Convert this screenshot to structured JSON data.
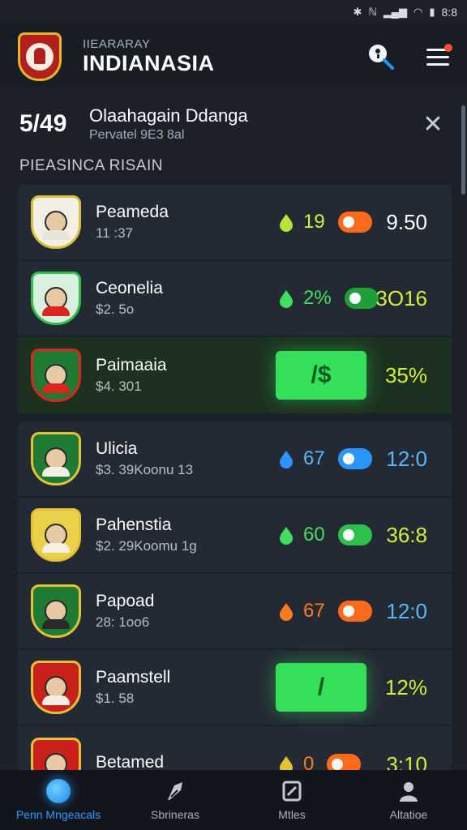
{
  "status_bar": {
    "time": "8:8"
  },
  "app": {
    "brand_sub": "IIEARARAY",
    "brand_title": "INDIANASIA"
  },
  "header": {
    "score": "5/49",
    "title": "Olaahagain Ddanga",
    "subtitle": "Pervatel 9E3 8al"
  },
  "section_label": "PIEASINCA RISAIN",
  "colors": {
    "yellow_green": "#d4ef3a",
    "green": "#34e05a",
    "blue": "#2a95ff",
    "orange": "#ff6a1a",
    "white": "#ffffff",
    "cyan": "#58b8ff"
  },
  "group1": [
    {
      "name": "Peameda",
      "sub": "11 :37",
      "metric": "19",
      "odds": "9.50",
      "metric_color": "#d4ef3a",
      "drop_color": "#b7e33a",
      "toggle_bg": "#ff6a1a",
      "knob_color": "#ff6a1a",
      "odds_color": "#ffffff",
      "crest_bg": "#f4efe4",
      "crest_border": "#d8c13a",
      "shirt": "#e7e4da"
    },
    {
      "name": "Ceonelia",
      "sub": "$2. 5o",
      "metric": "2%",
      "odds": "3O16",
      "metric_color": "#3fe060",
      "drop_color": "#3fe060",
      "toggle_bg": "#1f9f3a",
      "knob_color": "#1f9f3a",
      "odds_color": "#d4ef3a",
      "crest_bg": "#d9efe0",
      "crest_border": "#2fbf4a",
      "shirt": "#d9261f"
    },
    {
      "name": "Paimaaia",
      "sub": "$4. 301",
      "cta": "/$",
      "odds": "35%",
      "odds_color": "#d4ef3a",
      "highlight": true,
      "crest_bg": "#1f7a34",
      "crest_border": "#d9261f",
      "shirt": "#d9261f"
    }
  ],
  "group2": [
    {
      "name": "Ulicia",
      "sub": "$3. 39Koonu 13",
      "metric": "67",
      "odds": "12:0",
      "metric_color": "#58b8ff",
      "drop_color": "#2a95ff",
      "toggle_bg": "#2a95ff",
      "knob_color": "#2a95ff",
      "odds_color": "#58b8ff",
      "crest_bg": "#1f7a34",
      "crest_border": "#e4c235",
      "shirt": "#f4efe4"
    },
    {
      "name": "Pahenstia",
      "sub": "$2. 29Koomu 1g",
      "metric": "60",
      "odds": "36:8",
      "metric_color": "#3fe060",
      "drop_color": "#3fe060",
      "toggle_bg": "#2ec04a",
      "knob_color": "#2ec04a",
      "odds_color": "#d4ef3a",
      "crest_bg": "#e9d24a",
      "crest_border": "#e4c235",
      "shirt": "#f4efe4"
    },
    {
      "name": "Papoad",
      "sub": "28: 1oo6",
      "metric": "67",
      "odds": "12:0",
      "metric_color": "#ff7a22",
      "drop_color": "#ff7a22",
      "toggle_bg": "#ff6a1a",
      "knob_color": "#ff6a1a",
      "odds_color": "#58b8ff",
      "crest_bg": "#1f7a34",
      "crest_border": "#e4c235",
      "shirt": "#2a2a2a"
    },
    {
      "name": "Paamstell",
      "sub": "$1. 58",
      "cta": "/",
      "odds": "12%",
      "odds_color": "#d4ef3a",
      "highlight": false,
      "crest_bg": "#c9201c",
      "crest_border": "#e4c235",
      "shirt": "#f4efe4"
    },
    {
      "name": "Betamed",
      "sub": "",
      "metric": "0",
      "odds": "3:10",
      "metric_color": "#ff7a22",
      "drop_color": "#e4c235",
      "toggle_bg": "#ff6a1a",
      "knob_color": "#ff6a1a",
      "odds_color": "#d4ef3a",
      "crest_bg": "#c9201c",
      "crest_border": "#e4c235",
      "shirt": "#f4efe4"
    }
  ],
  "tabs": [
    {
      "label": "Penn Mngeacals",
      "icon": "home-orb-icon",
      "active": true
    },
    {
      "label": "Sbrineras",
      "icon": "rocket-icon",
      "active": false
    },
    {
      "label": "Mtles",
      "icon": "document-icon",
      "active": false
    },
    {
      "label": "Altatioe",
      "icon": "profile-icon",
      "active": false
    }
  ]
}
